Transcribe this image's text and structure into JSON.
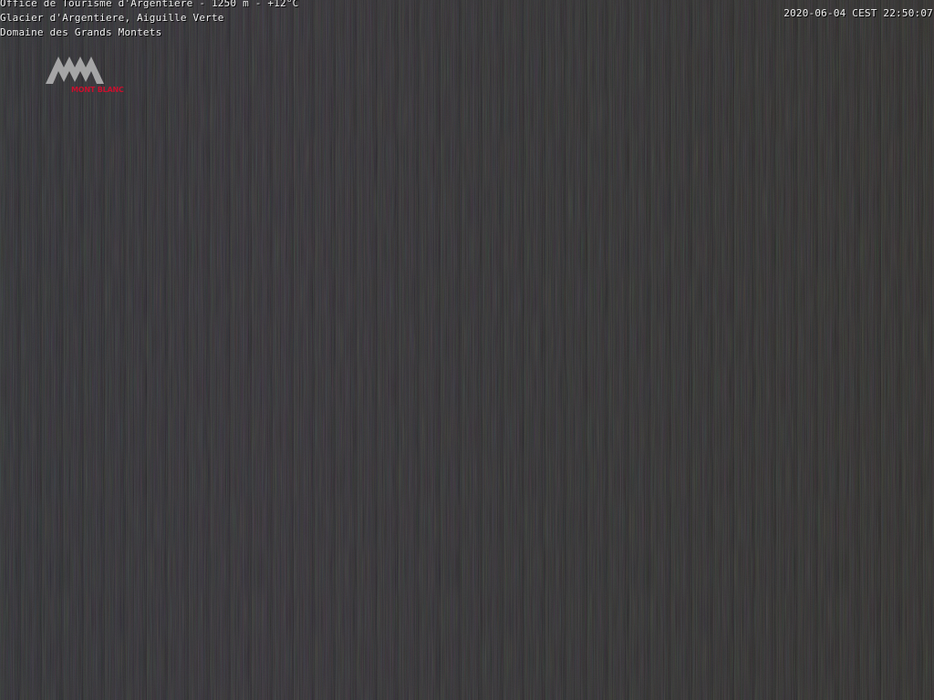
{
  "overlay": {
    "line1": "Office de Tourisme d'Argentiere - 1250 m - +12°C",
    "line2": "Glacier d'Argentiere, Aiguille Verte",
    "line3": "Domaine des Grands Montets",
    "timestamp": "2020-06-04 CEST 22:50:07"
  },
  "logo": {
    "icon": "mountain-logo-icon",
    "text": "MONT BLANC",
    "mountain_color": "#b9b9b9",
    "text_color": "#c8102e"
  }
}
